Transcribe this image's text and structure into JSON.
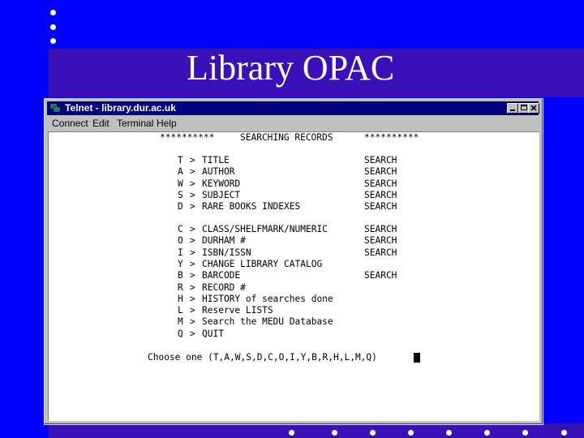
{
  "slide": {
    "title": "Library OPAC"
  },
  "window": {
    "title": "Telnet - library.dur.ac.uk",
    "buttons": [
      "minimize",
      "maximize",
      "close"
    ],
    "titlebar_color": "#000080"
  },
  "menubar": {
    "items": [
      "Connect",
      "Edit",
      "Terminal",
      "Help"
    ]
  },
  "terminal": {
    "header": {
      "left": "**********",
      "title": "SEARCHING RECORDS",
      "right": "**********"
    },
    "group1": [
      {
        "key": "T",
        "label": "TITLE",
        "action": "SEARCH"
      },
      {
        "key": "A",
        "label": "AUTHOR",
        "action": "SEARCH"
      },
      {
        "key": "W",
        "label": "KEYWORD",
        "action": "SEARCH"
      },
      {
        "key": "S",
        "label": "SUBJECT",
        "action": "SEARCH"
      },
      {
        "key": "D",
        "label": "RARE BOOKS INDEXES",
        "action": "SEARCH"
      }
    ],
    "group2": [
      {
        "key": "C",
        "label": "CLASS/SHELFMARK/NUMERIC",
        "action": "SEARCH"
      },
      {
        "key": "O",
        "label": "DURHAM #",
        "action": "SEARCH"
      },
      {
        "key": "I",
        "label": "ISBN/ISSN",
        "action": "SEARCH"
      },
      {
        "key": "Y",
        "label": "CHANGE LIBRARY CATALOG",
        "action": ""
      },
      {
        "key": "B",
        "label": "BARCODE",
        "action": "SEARCH"
      },
      {
        "key": "R",
        "label": "RECORD #",
        "action": ""
      },
      {
        "key": "H",
        "label": "HISTORY of searches done",
        "action": ""
      },
      {
        "key": "L",
        "label": "Reserve LISTS",
        "action": ""
      },
      {
        "key": "M",
        "label": "Search the MEDU Database",
        "action": ""
      },
      {
        "key": "Q",
        "label": "QUIT",
        "action": ""
      }
    ],
    "prompt": "Choose one (T,A,W,S,D,C,O,I,Y,B,R,H,L,M,Q)",
    "arrow": ">"
  },
  "colors": {
    "slide_background": "#0000ff",
    "band": "#3a10b8",
    "bullet": "#ffffff"
  }
}
